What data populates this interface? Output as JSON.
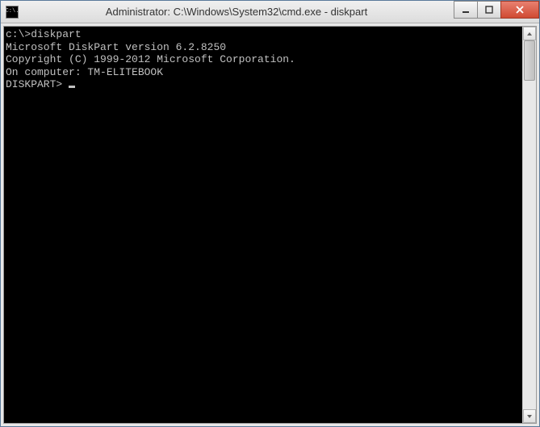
{
  "window": {
    "title": "Administrator: C:\\Windows\\System32\\cmd.exe - diskpart",
    "icon_label": "C:\\."
  },
  "console": {
    "lines": [
      "c:\\>diskpart",
      "",
      "Microsoft DiskPart version 6.2.8250",
      "",
      "Copyright (C) 1999-2012 Microsoft Corporation.",
      "On computer: TM-ELITEBOOK",
      "",
      "DISKPART>"
    ]
  }
}
